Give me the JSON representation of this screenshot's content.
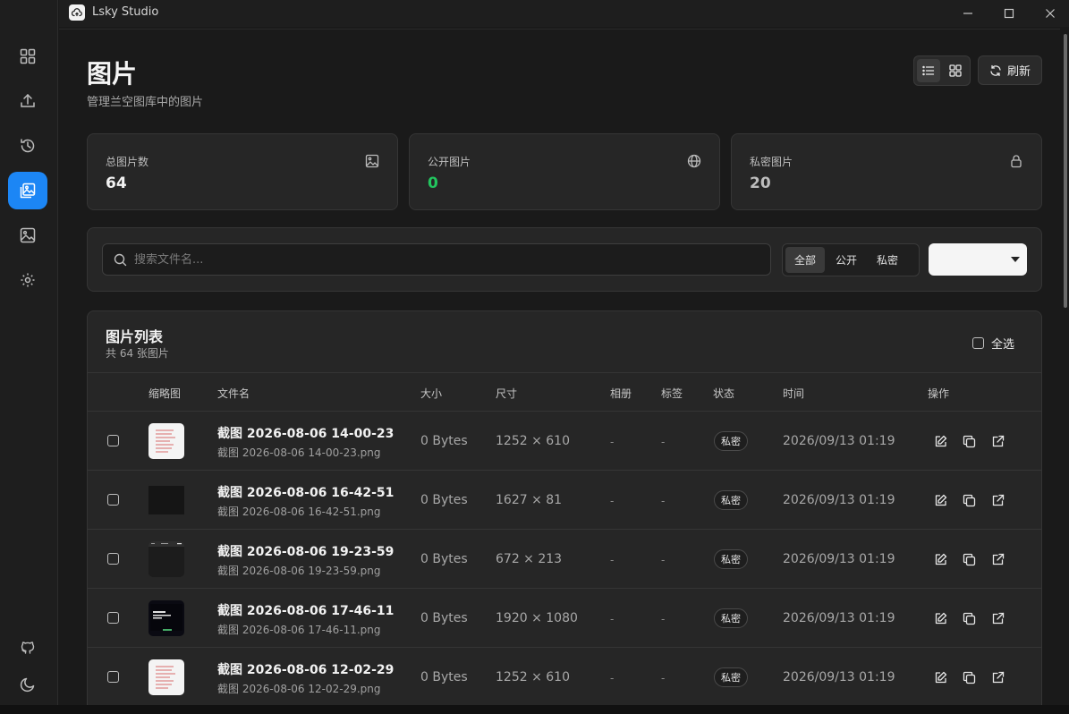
{
  "window": {
    "title": "Lsky Studio"
  },
  "sidebar": {
    "items": [
      {
        "name": "dashboard-icon"
      },
      {
        "name": "upload-icon"
      },
      {
        "name": "history-icon"
      },
      {
        "name": "gallery-icon",
        "active": true
      },
      {
        "name": "image-icon"
      },
      {
        "name": "settings-icon"
      }
    ],
    "bottom": [
      {
        "name": "github-icon"
      },
      {
        "name": "moon-icon"
      }
    ]
  },
  "page": {
    "title": "图片",
    "subtitle": "管理兰空图库中的图片"
  },
  "toolbar": {
    "refresh_label": "刷新"
  },
  "stats": [
    {
      "label": "总图片数",
      "value": "64",
      "color": "#f2f2f2",
      "icon": "image-icon"
    },
    {
      "label": "公开图片",
      "value": "0",
      "color": "#22c55e",
      "icon": "globe-icon"
    },
    {
      "label": "私密图片",
      "value": "20",
      "color": "#bdbdbd",
      "icon": "lock-icon"
    }
  ],
  "filter": {
    "search_placeholder": "搜索文件名...",
    "segments": [
      {
        "label": "全部",
        "active": true
      },
      {
        "label": "公开"
      },
      {
        "label": "私密"
      }
    ]
  },
  "list": {
    "title": "图片列表",
    "subtitle": "共 64 张图片",
    "select_all_label": "全选",
    "headers": {
      "thumb": "缩略图",
      "name": "文件名",
      "size": "大小",
      "dims": "尺寸",
      "album": "相册",
      "tags": "标签",
      "status": "状态",
      "time": "时间",
      "actions": "操作"
    },
    "rows": [
      {
        "name": "截图 2026-08-06 14-00-23",
        "file": "截图 2026-08-06 14-00-23.png",
        "size": "0 Bytes",
        "dims": "1252 × 610",
        "album": "-",
        "tags": "-",
        "status": "私密",
        "time": "2026/09/13 01:19",
        "thumb": "doc"
      },
      {
        "name": "截图 2026-08-06 16-42-51",
        "file": "截图 2026-08-06 16-42-51.png",
        "size": "0 Bytes",
        "dims": "1627 × 81",
        "album": "-",
        "tags": "-",
        "status": "私密",
        "time": "2026/09/13 01:19",
        "thumb": "dark"
      },
      {
        "name": "截图 2026-08-06 19-23-59",
        "file": "截图 2026-08-06 19-23-59.png",
        "size": "0 Bytes",
        "dims": "672 × 213",
        "album": "-",
        "tags": "-",
        "status": "私密",
        "time": "2026/09/13 01:19",
        "thumb": "bar"
      },
      {
        "name": "截图 2026-08-06 17-46-11",
        "file": "截图 2026-08-06 17-46-11.png",
        "size": "0 Bytes",
        "dims": "1920 × 1080",
        "album": "-",
        "tags": "-",
        "status": "私密",
        "time": "2026/09/13 01:19",
        "thumb": "screen"
      },
      {
        "name": "截图 2026-08-06 12-02-29",
        "file": "截图 2026-08-06 12-02-29.png",
        "size": "0 Bytes",
        "dims": "1252 × 610",
        "album": "-",
        "tags": "-",
        "status": "私密",
        "time": "2026/09/13 01:19",
        "thumb": "doc"
      }
    ]
  }
}
